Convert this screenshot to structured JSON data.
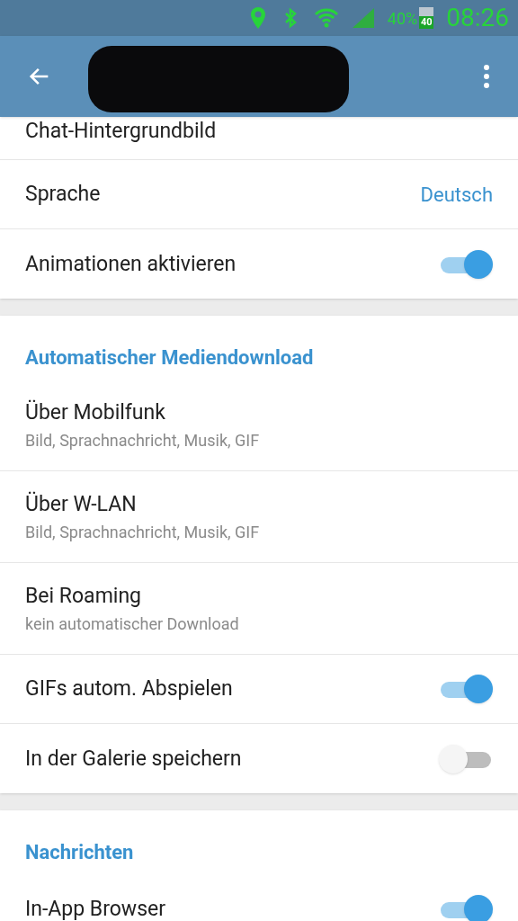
{
  "status_bar": {
    "battery": "40%",
    "battery_badge": "40",
    "time": "08:26"
  },
  "sections": [
    {
      "items": [
        {
          "kind": "plain",
          "title": "Chat-Hintergrundbild"
        },
        {
          "kind": "value",
          "title": "Sprache",
          "value": "Deutsch"
        },
        {
          "kind": "switch",
          "title": "Animationen aktivieren",
          "on": true
        }
      ]
    },
    {
      "header": "Automatischer Mediendownload",
      "items": [
        {
          "kind": "subtitle",
          "title": "Über Mobilfunk",
          "subtitle": "Bild, Sprachnachricht, Musik, GIF"
        },
        {
          "kind": "subtitle",
          "title": "Über W-LAN",
          "subtitle": "Bild, Sprachnachricht, Musik, GIF"
        },
        {
          "kind": "subtitle",
          "title": "Bei Roaming",
          "subtitle": "kein automatischer Download"
        },
        {
          "kind": "switch",
          "title": "GIFs autom. Abspielen",
          "on": true
        },
        {
          "kind": "switch",
          "title": "In der Galerie speichern",
          "on": false
        }
      ]
    },
    {
      "header": "Nachrichten",
      "items": [
        {
          "kind": "switch",
          "title": "In-App Browser",
          "on": true
        }
      ]
    }
  ]
}
